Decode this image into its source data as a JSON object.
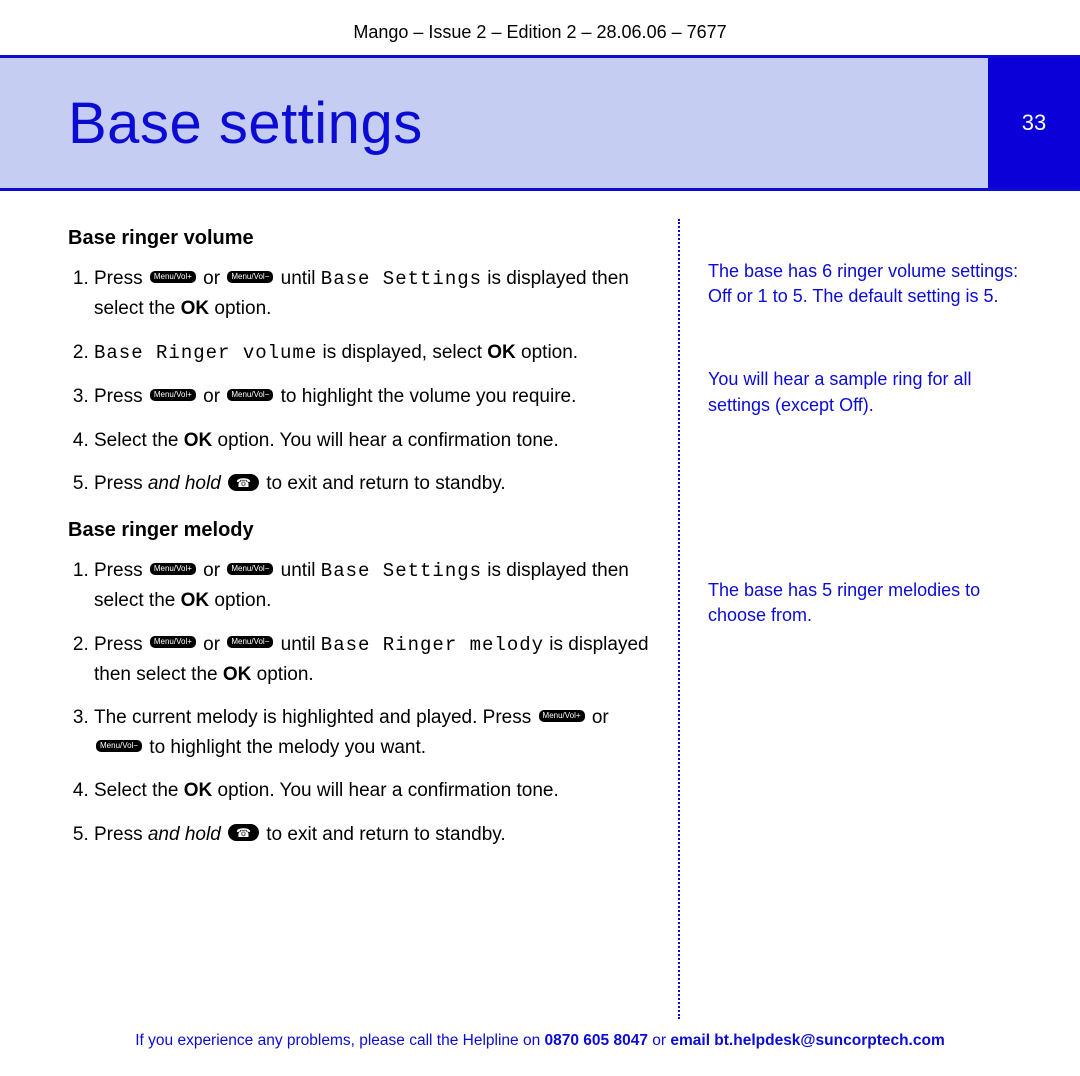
{
  "header_line": "Mango – Issue 2 – Edition 2 – 28.06.06 – 7677",
  "title": "Base settings",
  "page_number": "33",
  "btn_plus_label": "Menu/Vol+",
  "btn_minus_label": "Menu/Vol−",
  "s1": {
    "heading": "Base ringer volume",
    "li1_a": "Press ",
    "li1_b": " or ",
    "li1_c": " until ",
    "li1_disp": "Base Settings",
    "li1_d": " is displayed then select the ",
    "li1_ok": "OK",
    "li1_e": " option.",
    "li2_disp": "Base Ringer volume",
    "li2_a": " is displayed, select ",
    "li2_ok": "OK",
    "li2_b": " option.",
    "li3_a": "Press ",
    "li3_b": " or ",
    "li3_c": " to highlight the volume you require.",
    "li4_a": "Select the ",
    "li4_ok": "OK",
    "li4_b": " option. You will hear a confirmation tone.",
    "li5_a": "Press ",
    "li5_it": "and hold",
    "li5_b": " ",
    "li5_c": " to exit and return to standby."
  },
  "s2": {
    "heading": "Base ringer melody",
    "li1_a": "Press ",
    "li1_b": " or ",
    "li1_c": " until ",
    "li1_disp": "Base Settings",
    "li1_d": " is displayed then select the ",
    "li1_ok": "OK",
    "li1_e": " option.",
    "li2_a": "Press ",
    "li2_b": " or ",
    "li2_c": " until ",
    "li2_disp": "Base Ringer melody",
    "li2_d": " is displayed then select the ",
    "li2_ok": "OK",
    "li2_e": " option.",
    "li3_a": "The current melody is highlighted and played. Press ",
    "li3_b": " or ",
    "li3_c": " to highlight the melody you want.",
    "li4_a": "Select the ",
    "li4_ok": "OK",
    "li4_b": " option. You will hear a confirmation tone.",
    "li5_a": "Press ",
    "li5_it": "and hold",
    "li5_b": " ",
    "li5_c": " to exit and return to standby."
  },
  "notes": {
    "n1": "The base has 6 ringer volume settings: Off or 1 to 5. The default setting is 5.",
    "n2": "You will hear a sample ring for all settings (except Off).",
    "n3": "The base has 5 ringer melodies to choose from."
  },
  "footer": {
    "a": "If you experience any problems, please call the Helpline on ",
    "b": "0870 605 8047",
    "c": " or ",
    "d": "email bt.helpdesk@suncorptech.com"
  }
}
